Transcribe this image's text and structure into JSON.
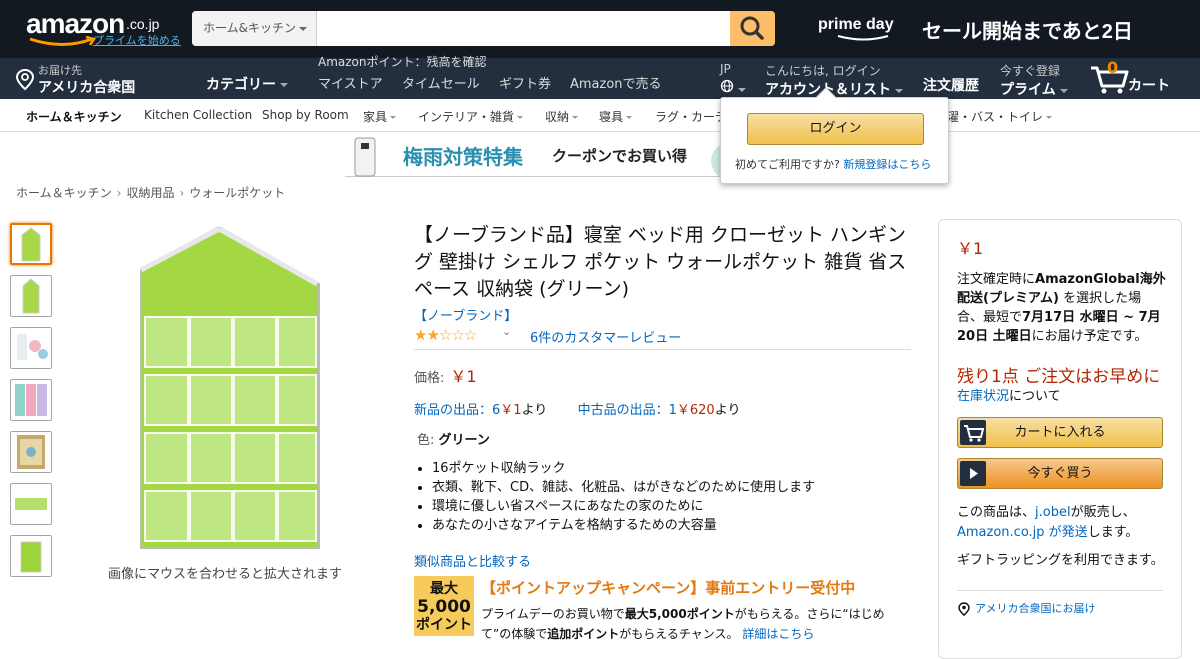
{
  "header": {
    "logo_text": "amazon",
    "logo_tld": ".co.jp",
    "prime_link": "プライムを始める",
    "search_category": "ホーム&キッチン",
    "search_value": "",
    "primeday_label": "prime day",
    "sale_banner": "セール開始まであと2日"
  },
  "nav": {
    "deliver_line1": "お届け先",
    "deliver_line2": "アメリカ合衆国",
    "category_label": "カテゴリー",
    "points_text": "Amazonポイント：残高を確認",
    "links": [
      "マイストア",
      "タイムセール",
      "ギフト券",
      "Amazonで売る"
    ],
    "lang": "JP",
    "account_line1": "こんにちは, ログイン",
    "account_line2": "アカウント＆リスト",
    "orders": "注文履歴",
    "prime_line1": "今すぐ登録",
    "prime_line2": "プライム",
    "cart_count": "0",
    "cart_label": "カート"
  },
  "subnav": {
    "items": [
      "ホーム＆キッチン",
      "Kitchen Collection",
      "Shop by Room",
      "家具",
      "インテリア・雑貨",
      "収納",
      "寝具",
      "ラグ・カーテン",
      "洗濯・バス・トイレ"
    ]
  },
  "banner": {
    "title": "梅雨対策特集",
    "subtitle": "クーポンでお買い得"
  },
  "breadcrumb": [
    "ホーム＆キッチン",
    "収納用品",
    "ウォールポケット"
  ],
  "gallery": {
    "hover_hint": "画像にマウスを合わせると拡大されます"
  },
  "product": {
    "title": "【ノーブランド品】寝室 ベッド用 クローゼット ハンギング 壁掛け シェルフ ポケット ウォールポケット 雑貨 省スペース 収納袋 (グリーン)",
    "brand": "【ノーブランド】",
    "stars_text": "★★☆☆☆",
    "rating": 1.5,
    "reviews": "6件のカスタマーレビュー",
    "price_label": "価格:",
    "price": "￥1",
    "new_offers_prefix": "新品の出品：6",
    "new_offers_price": "￥1",
    "new_offers_suffix": "より",
    "used_offers_prefix": "中古品の出品：1",
    "used_offers_price": "￥620",
    "used_offers_suffix": "より",
    "color_label": "色:",
    "color_value": "グリーン",
    "bullets": [
      "16ポケット収納ラック",
      "衣類、靴下、CD、雑誌、化粧品、はがきなどのために使用します",
      "環境に優しい省スペースにあなたの家のために",
      "あなたの小さなアイテムを格納するための大容量"
    ],
    "compare_link": "類似商品と比較する"
  },
  "promo": {
    "badge_line1": "最大",
    "badge_line2": "5,000",
    "badge_line3": "ポイント",
    "title": "【ポイントアップキャンペーン】事前エントリー受付中",
    "desc_a": "プライムデーのお買い物で",
    "desc_b": "最大5,000ポイント",
    "desc_c": "がもらえる。さらに“はじめて”の体験で",
    "desc_d": "追加ポイント",
    "desc_e": "がもらえるチャンス。",
    "desc_link": "詳細はこちら"
  },
  "buybox": {
    "price": "￥1",
    "ship_a": "注文確定時に",
    "ship_b": "AmazonGlobal海外配送(プレミアム)",
    "ship_c": " を選択した場合、最短で",
    "ship_d": "7月17日 水曜日 ~ 7月20日 土曜日",
    "ship_e": "にお届け予定です。",
    "stock": "残り1点 ご注文はお早めに",
    "status_link": "在庫状況",
    "status_suffix": "について",
    "cart_button": "カートに入れる",
    "buy_button": "今すぐ買う",
    "seller_a": "この商品は、",
    "seller_link": "j.obel",
    "seller_b": "が販売し、",
    "seller_link2": "Amazon.co.jp が発送",
    "seller_c": "します。",
    "gift": "ギフトラッピングを利用できます。",
    "address": "アメリカ合衆国にお届け"
  },
  "popover": {
    "login_button": "ログイン",
    "new_customer": "初めてご利用ですか?",
    "register_link": "新規登録はこちら"
  },
  "colors": {
    "nav_dark": "#131921",
    "nav_mid": "#232f3e",
    "search_button": "#febd69",
    "price_red": "#b12704",
    "link_blue": "#0066c0",
    "product_green": "#9bd53a"
  }
}
